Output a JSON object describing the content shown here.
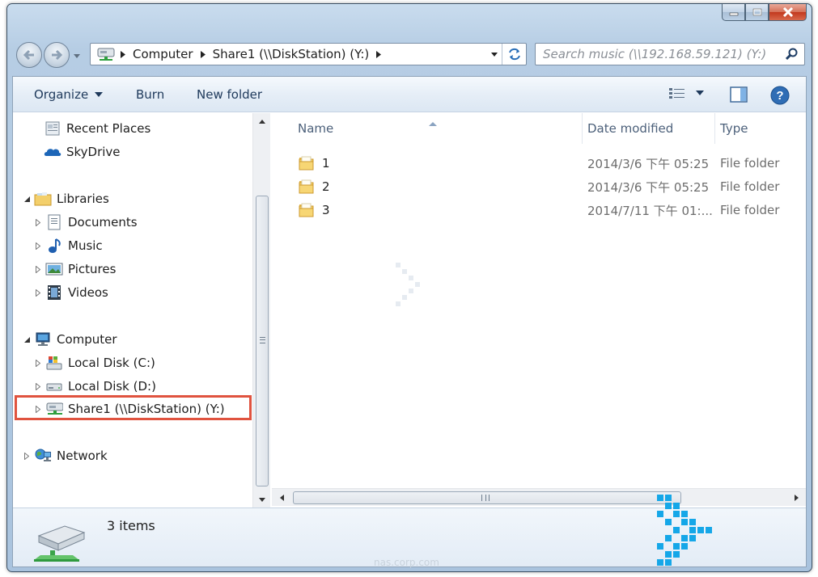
{
  "window": {
    "caption_buttons": [
      "minimize",
      "maximize",
      "close"
    ]
  },
  "navigation": {
    "address_crumbs": [
      "Computer",
      "Share1 (\\\\DiskStation) (Y:)"
    ],
    "search_placeholder": "Search music (\\\\192.168.59.121) (Y:)"
  },
  "toolbar": {
    "organize": "Organize",
    "burn": "Burn",
    "new_folder": "New folder"
  },
  "nav_pane": {
    "favorites": [
      {
        "label": "Recent Places",
        "icon": "recent-places-icon"
      },
      {
        "label": "SkyDrive",
        "icon": "skydrive-icon"
      }
    ],
    "libraries": {
      "label": "Libraries",
      "items": [
        "Documents",
        "Music",
        "Pictures",
        "Videos"
      ]
    },
    "computer": {
      "label": "Computer",
      "items": [
        "Local Disk (C:)",
        "Local Disk (D:)",
        "Share1 (\\\\DiskStation) (Y:)"
      ],
      "selected": "Share1 (\\\\DiskStation) (Y:)"
    },
    "network": {
      "label": "Network"
    }
  },
  "file_list": {
    "columns": {
      "name": "Name",
      "date": "Date modified",
      "type": "Type"
    },
    "rows": [
      {
        "name": "1",
        "date": "2014/3/6 下午 05:25",
        "type": "File folder"
      },
      {
        "name": "2",
        "date": "2014/3/6 下午 05:25",
        "type": "File folder"
      },
      {
        "name": "3",
        "date": "2014/7/11 下午 01:...",
        "type": "File folder"
      }
    ]
  },
  "details": {
    "item_count": "3 items"
  },
  "colors": {
    "selection_outline": "#e0533f",
    "link_text": "#1e395b",
    "watermark_blue": "#15a7e8"
  },
  "watermark": "nas.corp.com"
}
